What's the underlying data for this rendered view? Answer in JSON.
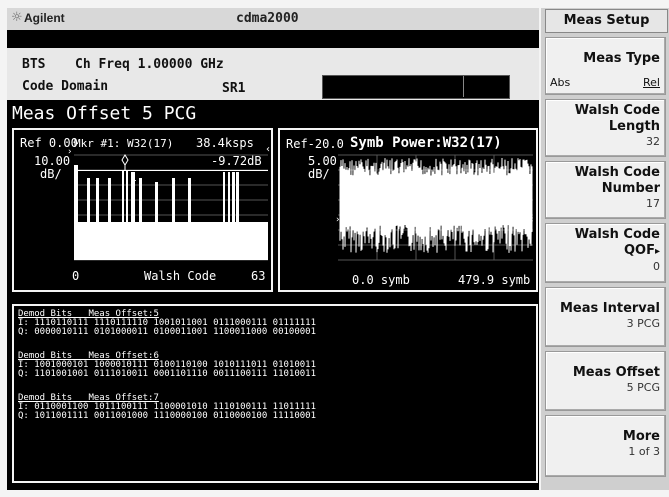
{
  "header": {
    "brand": "Agilent",
    "brand_icon": "sun-icon",
    "mode": "cdma2000"
  },
  "info": {
    "line1_left": "BTS",
    "line1_right": "Ch Freq 1.00000 GHz",
    "line2_left": "Code Domain",
    "line2_right": "SR1"
  },
  "meas_offset_title": "Meas Offset 5 PCG",
  "left_graph": {
    "ref": "Ref 0.00",
    "marker": "Mkr #1: W32(17)",
    "rate": "38.4ksps",
    "scale": "10.00",
    "unit": "dB/",
    "marker_value": "-9.72dB",
    "marker_num": "1",
    "x_start": "0",
    "x_label": "Walsh Code",
    "x_end": "63"
  },
  "right_graph": {
    "ref": "Ref-20.0",
    "title": "Symb Power:W32(17)",
    "scale": "5.00",
    "unit": "dB/",
    "x_start": "0.0 symb",
    "x_end": "479.9 symb"
  },
  "demod": [
    {
      "header": "Demod Bits   Meas Offset:5",
      "i": "I: 1110110111 1110111110 1001011001 0111000111 01111111",
      "q": "Q: 0000010111 0101000011 0100011001 1100011000 00100001"
    },
    {
      "header": "Demod Bits   Meas Offset:6",
      "i": "I: 1001000101 1000010111 0100110100 1010111011 01010011",
      "q": "Q: 1101001001 0111010011 0001101110 0011100111 11010011"
    },
    {
      "header": "Demod Bits   Meas Offset:7",
      "i": "I: 0110001100 1011100111 1100001010 1110100111 11011111",
      "q": "Q: 1011001111 0011001000 1110000100 0110000100 11110001"
    }
  ],
  "softkeys": {
    "menu_title": "Meas Setup",
    "meas_type": {
      "label": "Meas Type",
      "abs": "Abs",
      "rel": "Rel"
    },
    "walsh_len": {
      "label1": "Walsh Code",
      "label2": "Length",
      "value": "32"
    },
    "walsh_num": {
      "label1": "Walsh Code",
      "label2": "Number",
      "value": "17"
    },
    "walsh_qof": {
      "label1": "Walsh Code",
      "label2": "QOF",
      "arrow": "▸",
      "value": "0"
    },
    "meas_interval": {
      "label": "Meas Interval",
      "value": "3 PCG"
    },
    "meas_offset": {
      "label": "Meas Offset",
      "value": "5 PCG"
    },
    "more": {
      "label": "More",
      "value": "1 of 3"
    }
  }
}
